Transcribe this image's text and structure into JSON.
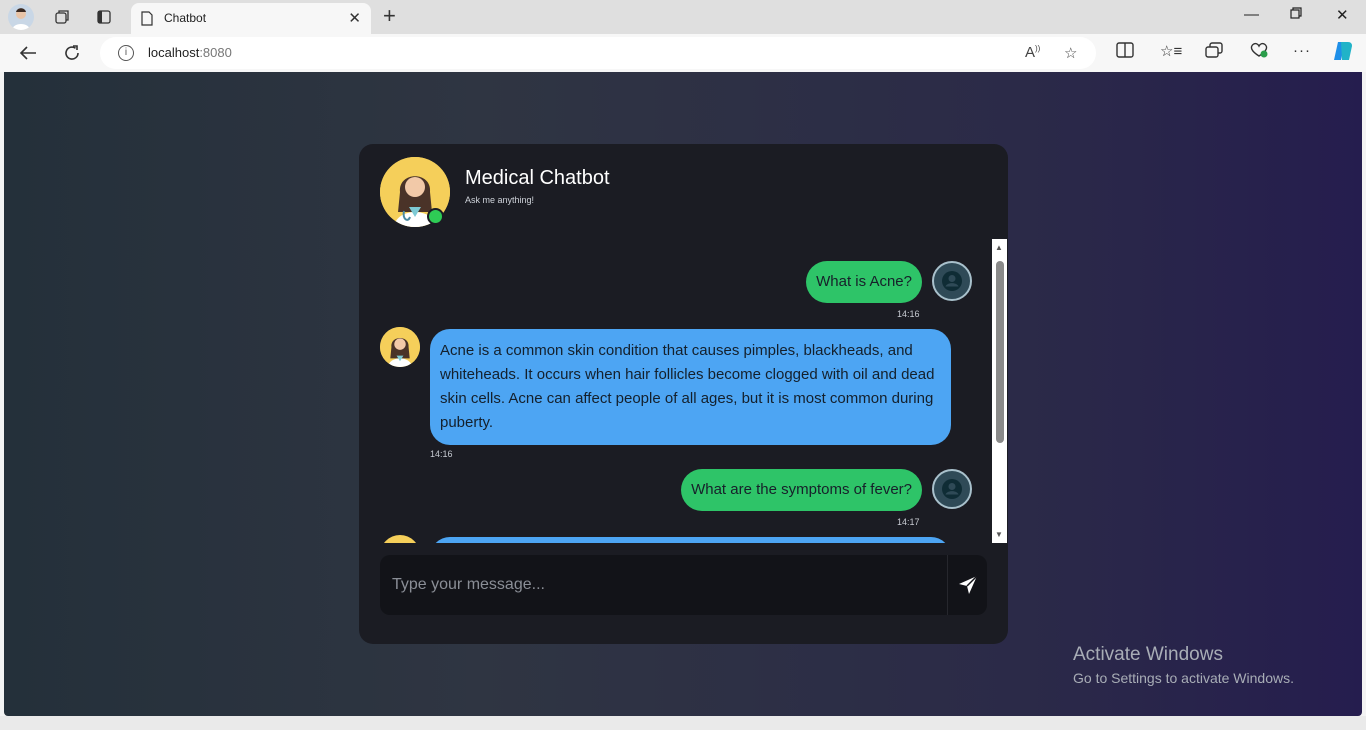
{
  "browser": {
    "tab_title": "Chatbot",
    "url_host": "localhost",
    "url_port": ":8080"
  },
  "chat": {
    "title": "Medical Chatbot",
    "subtitle": "Ask me anything!",
    "messages": [
      {
        "from": "user",
        "text": "What is Acne?",
        "time": "14:16"
      },
      {
        "from": "bot",
        "text": "Acne is a common skin condition that causes pimples, blackheads, and whiteheads. It occurs when hair follicles become clogged with oil and dead skin cells. Acne can affect people of all ages, but it is most common during puberty.",
        "time": "14:16"
      },
      {
        "from": "user",
        "text": "What are the symptoms of fever?",
        "time": "14:17"
      }
    ],
    "input_placeholder": "Type your message..."
  },
  "watermark": {
    "line1": "Activate Windows",
    "line2": "Go to Settings to activate Windows."
  },
  "colors": {
    "user_bubble": "#2ec468",
    "bot_bubble": "#4da5f3",
    "card": "#1b1c23",
    "online": "#2ecc55"
  }
}
